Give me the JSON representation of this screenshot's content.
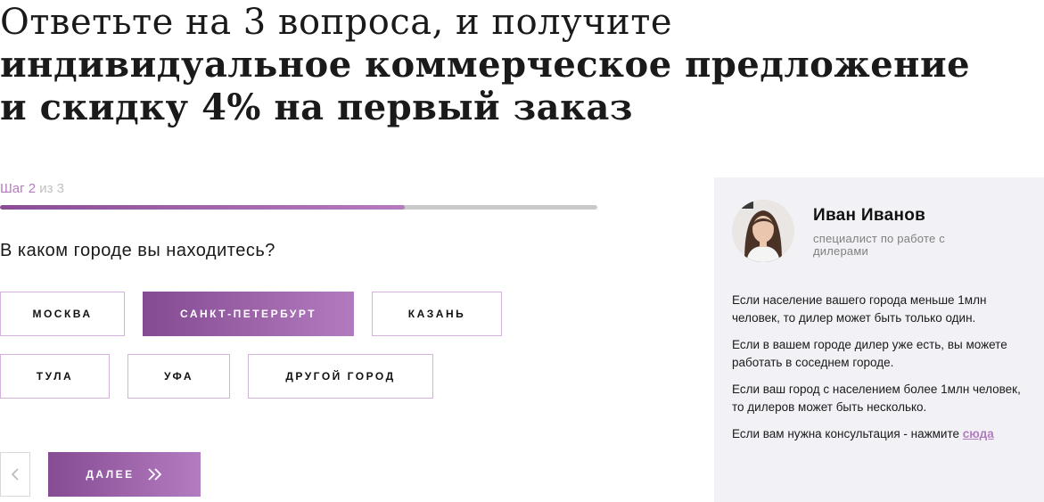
{
  "heading": {
    "regular": "Ответьте на 3 вопроса, и получите",
    "bold": "индивидуальное коммерческое предложение и скидку 4% на первый заказ"
  },
  "step": {
    "current": "Шаг 2",
    "total": "из 3",
    "progress_fraction": 0.677
  },
  "question": "В каком городе вы находитесь?",
  "options": [
    {
      "label": "МОСКВА",
      "selected": false
    },
    {
      "label": "САНКТ-ПЕТЕРБУРТ",
      "selected": true
    },
    {
      "label": "КАЗАНЬ",
      "selected": false
    },
    {
      "label": "ТУЛА",
      "selected": false
    },
    {
      "label": "УФА",
      "selected": false
    },
    {
      "label": "ДРУГОЙ ГОРОД",
      "selected": false
    }
  ],
  "nav": {
    "next_label": "ДАЛЕЕ",
    "back_icon": "chevron-left-icon",
    "next_icon": "double-chevron-right-icon"
  },
  "sidebar": {
    "name": "Иван Иванов",
    "role": "специалист по работе с дилерами",
    "paragraphs": [
      "Если население вашего города меньше 1млн человек, то дилер может быть только один.",
      "Если в вашем городе дилер уже есть, вы можете работать в соседнем городе.",
      "Если ваш город с населением более  1млн человек, то дилеров может быть несколько."
    ],
    "consult_text": "Если вам нужна консультация - нажмите",
    "consult_link": "сюда"
  },
  "colors": {
    "accent": "#b47cc0",
    "accent_dark": "#844a92",
    "card_bg": "#f2f1f6",
    "option_border": "#d4b3db",
    "track": "#c9c9c9"
  }
}
